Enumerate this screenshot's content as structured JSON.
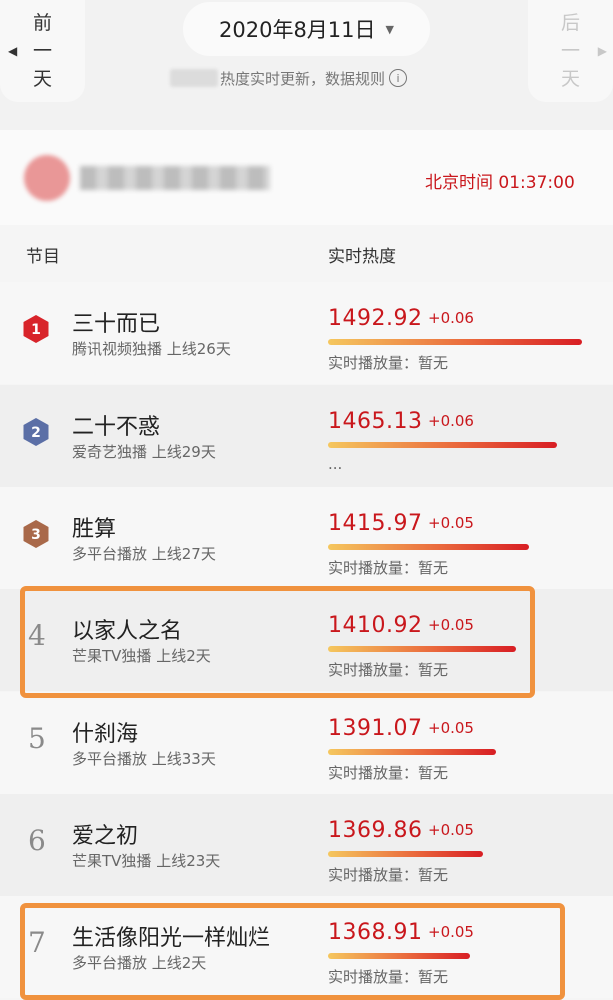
{
  "nav": {
    "prev_label": "前一天",
    "next_label": "后一天",
    "date": "2020年8月11日",
    "subtitle": "热度实时更新，数据规则",
    "info_icon": "info-icon"
  },
  "account": {
    "time_label": "北京时间 01:37:00"
  },
  "columns": {
    "program": "节目",
    "heat": "实时热度"
  },
  "rows": [
    {
      "rank": "1",
      "title": "三十而已",
      "meta": "腾讯视频独播  上线26天",
      "score": "1492.92",
      "delta": "+0.06",
      "play": "实时播放量：暂无",
      "heat_share": 1.0
    },
    {
      "rank": "2",
      "title": "二十不惑",
      "meta": "爱奇艺独播  上线29天",
      "score": "1465.13",
      "delta": "+0.06",
      "play": "...",
      "heat_share": 0.903
    },
    {
      "rank": "3",
      "title": "胜算",
      "meta": "多平台播放  上线27天",
      "score": "1415.97",
      "delta": "+0.05",
      "play": "实时播放量：暂无",
      "heat_share": 0.79
    },
    {
      "rank": "4",
      "title": "以家人之名",
      "meta": "芒果TV独播  上线2天",
      "score": "1410.92",
      "delta": "+0.05",
      "play": "实时播放量：暂无",
      "heat_share": 0.74
    },
    {
      "rank": "5",
      "title": "什刹海",
      "meta": "多平台播放  上线33天",
      "score": "1391.07",
      "delta": "+0.05",
      "play": "实时播放量：暂无",
      "heat_share": 0.66
    },
    {
      "rank": "6",
      "title": "爱之初",
      "meta": "芒果TV独播  上线23天",
      "score": "1369.86",
      "delta": "+0.05",
      "play": "实时播放量：暂无",
      "heat_share": 0.61
    },
    {
      "rank": "7",
      "title": "生活像阳光一样灿烂",
      "meta": "多平台播放  上线2天",
      "score": "1368.91",
      "delta": "+0.05",
      "play": "实时播放量：暂无",
      "heat_share": 0.56
    }
  ],
  "badge_colors": {
    "1": "#d8242a",
    "2": "#5b6fa6",
    "3": "#a9694a"
  },
  "highlight_color": "#f0923e"
}
